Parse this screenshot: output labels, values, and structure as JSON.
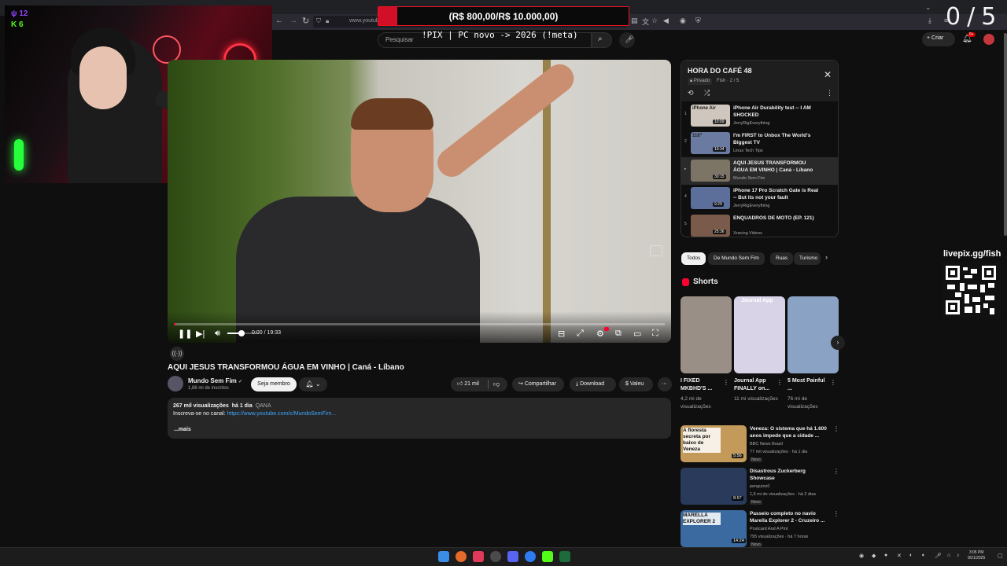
{
  "overlay": {
    "donation_text": "(R$ 800,00/R$ 10.000,00)",
    "counter": "0/5",
    "chat_count_twitch": "12",
    "chat_count_kick": "6",
    "stream_title": "!PIX | PC novo -> 2026 (!meta)",
    "qr_label": "livepix.gg/fish"
  },
  "browser": {
    "url": "www.youtube.com/watch?v=..."
  },
  "masthead": {
    "search_placeholder": "Pesquisar",
    "create_label": "Criar",
    "bell_badge": "9+"
  },
  "player": {
    "time": "0:00 / 19:33",
    "progress": 0.003,
    "volume": 0.45
  },
  "video": {
    "title": "AQUI JESUS TRANSFORMOU ÁGUA EM VINHO | Caná - Líbano",
    "channel": "Mundo Sem Fim",
    "subscribers": "1,86 mi de inscritos",
    "join_label": "Seja membro",
    "likes": "21 mil",
    "share_label": "Compartilhar",
    "download_label": "Download",
    "thanks_label": "Valeu",
    "views": "267 mil visualizações",
    "age": "há 1 dia",
    "tag": "QANA",
    "desc_prefix": "Inscreva-se no canal:",
    "desc_link": "https://www.youtube.com/c/MundoSemFim...",
    "more_label": "...mais"
  },
  "playlist": {
    "title": "HORA DO CAFÉ 48",
    "privacy": "Privado",
    "owner": "Fish · 2 / 5",
    "items": [
      {
        "num": "1",
        "title": "iPhone Air Durability test -- I AM SHOCKED",
        "channel": "JerryRigEverything",
        "duration": "10:09",
        "thumb": "#cfc6bd",
        "thumb_text": "iPhone Air"
      },
      {
        "num": "2",
        "title": "I'm FIRST to Unbox The World's Biggest TV",
        "channel": "Linus Tech Tips",
        "duration": "19:34",
        "thumb": "#6a7aa0",
        "thumb_text": "116\""
      },
      {
        "num": "▸",
        "title": "AQUI JESUS TRANSFORMOU ÁGUA EM VINHO | Caná - Líbano",
        "channel": "Mundo Sem Fim",
        "duration": "30:15",
        "thumb": "#7c7565",
        "thumb_text": ""
      },
      {
        "num": "4",
        "title": "iPhone 17 Pro Scratch Gate is Real -- But its not your fault",
        "channel": "JerryRigEverything",
        "duration": "9:29",
        "thumb": "#5c6e9a",
        "thumb_text": ""
      },
      {
        "num": "5",
        "title": "ENQUADROS DE MOTO (EP. 121)",
        "channel": "Xracing Videos",
        "duration": "25:36",
        "thumb": "#7a5a4a",
        "thumb_text": ""
      }
    ]
  },
  "chips": [
    "Todos",
    "De Mundo Sem Fim",
    "Ruas",
    "Turismo"
  ],
  "shorts": {
    "label": "Shorts",
    "items": [
      {
        "title": "I FIXED MKBHD'S ...",
        "views": "4,2 mi de visualizações",
        "thumb": "#9a8f86"
      },
      {
        "title": "Journal App FINALLY on...",
        "views": "11 mi visualizações",
        "thumb": "#d9d3e8",
        "thumb_text": "Journal App"
      },
      {
        "title": "5 Most Painful ...",
        "views": "76 mi de visualizações",
        "thumb": "#8aa3c4"
      }
    ]
  },
  "recommendations": [
    {
      "title": "Veneza: O sistema que há 1.600 anos impede que a cidade ...",
      "channel": "BBC News Brasil",
      "meta": "77 mil visualizações · há 1 dia",
      "badge": "Novo",
      "duration": "5:56",
      "thumb": "#c49a5a",
      "thumb_text": "A floresta secreta por baixo de Veneza"
    },
    {
      "title": "Disastrous Zuckerberg Showcase",
      "channel": "penguinz0",
      "meta": "1,6 mi de visualizações · há 2 dias",
      "badge": "Novo",
      "duration": "8:57",
      "thumb": "#2a3a5a",
      "thumb_text": ""
    },
    {
      "title": "Passeio completo no navio Marella Explorer 2 - Cruzeiro ...",
      "channel": "Postcard And A Pint",
      "meta": "795 visualizações · há 7 horas",
      "badge": "Novo",
      "duration": "14:24",
      "thumb": "#3a6aa0",
      "thumb_text": "MARELLA EXPLORER 2"
    }
  ],
  "taskbar": {
    "time": "3:05 PM",
    "date": "9/21/2025"
  }
}
